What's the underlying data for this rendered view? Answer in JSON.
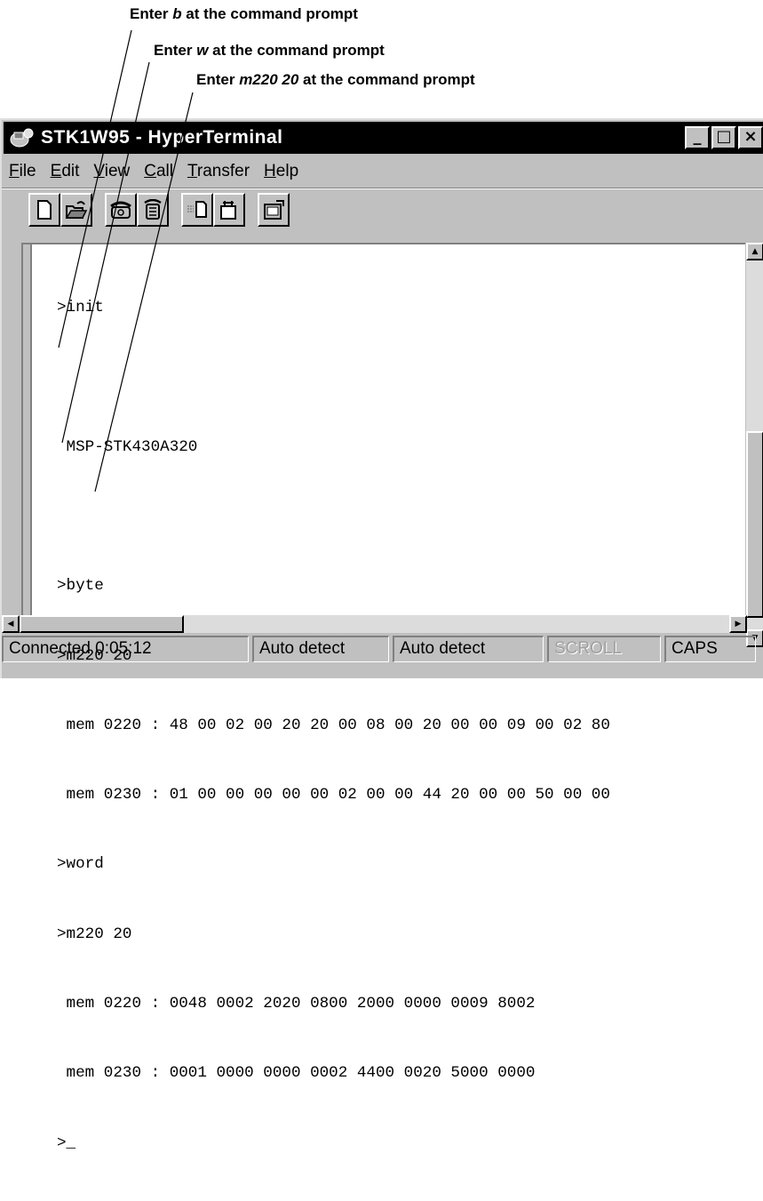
{
  "callouts": [
    {
      "prefix": "Enter ",
      "command": "b",
      "suffix": " at the command prompt"
    },
    {
      "prefix": "Enter ",
      "command": "w",
      "suffix": " at the command prompt"
    },
    {
      "prefix": "Enter ",
      "command": "m220 20",
      "suffix": " at the command prompt"
    }
  ],
  "window": {
    "title": "STK1W95 - HyperTerminal",
    "caption_buttons": {
      "minimize": "_",
      "maximize": "□",
      "close": "×"
    }
  },
  "menu": [
    {
      "accel": "F",
      "rest": "ile"
    },
    {
      "accel": "E",
      "rest": "dit"
    },
    {
      "accel": "V",
      "rest": "iew"
    },
    {
      "accel": "C",
      "rest": "all"
    },
    {
      "accel": "T",
      "rest": "ransfer"
    },
    {
      "accel": "H",
      "rest": "elp"
    }
  ],
  "toolbar": {
    "buttons": [
      "new-icon",
      "open-icon",
      "connect-icon",
      "disconnect-icon",
      "send-icon",
      "receive-icon",
      "properties-icon"
    ]
  },
  "terminal": {
    "lines": [
      ">init",
      "",
      " MSP-STK430A320",
      "",
      ">byte",
      ">m220 20",
      " mem 0220 : 48 00 02 00 20 20 00 08 00 20 00 00 09 00 02 80",
      " mem 0230 : 01 00 00 00 00 00 02 00 00 44 20 00 00 50 00 00",
      ">word",
      ">m220 20",
      " mem 0220 : 0048 0002 2020 0800 2000 0000 0009 8002",
      " mem 0230 : 0001 0000 0000 0002 4400 0020 5000 0000",
      ">_"
    ]
  },
  "status": {
    "connected": "Connected 0:05:12",
    "detect1": "Auto detect",
    "detect2": "Auto detect",
    "scroll": "SCROLL",
    "caps": "CAPS"
  }
}
